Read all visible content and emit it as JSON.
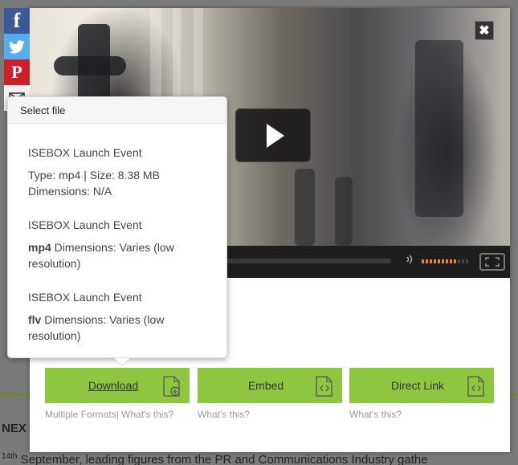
{
  "social": {
    "facebook": "f",
    "pinterest": "P",
    "icons": [
      "facebook-icon",
      "twitter-icon",
      "pinterest-icon",
      "mail-icon"
    ]
  },
  "background": {
    "heading_fragment": "NEX",
    "body_fragment_sup": "14th",
    "body_fragment": " September, leading figures from the PR and Communications Industry gathe"
  },
  "video": {
    "close_label": "✖",
    "volume_level": 0.75
  },
  "select_file": {
    "header": "Select file",
    "items": [
      {
        "title": "ISEBOX Launch Event",
        "line1": "Type: mp4 | Size: 8.38 MB",
        "line2": "Dimensions: N/A"
      },
      {
        "title": "ISEBOX Launch Event",
        "format": "mp4",
        "desc": " Dimensions: Varies (low resolution)"
      },
      {
        "title": "ISEBOX Launch Event",
        "format": "flv",
        "desc": " Dimensions: Varies (low resolution)"
      }
    ]
  },
  "actions": {
    "download": {
      "label": "Download",
      "sub": "Multiple Formats| What's this?"
    },
    "embed": {
      "label": "Embed",
      "sub": "What's this?"
    },
    "direct_link": {
      "label": "Direct Link",
      "sub": "What's this?"
    }
  },
  "colors": {
    "accent_green": "#8dc63f",
    "volume_orange": "#e8872a",
    "facebook": "#3b5998",
    "twitter": "#55acee",
    "pinterest": "#cb2027"
  }
}
